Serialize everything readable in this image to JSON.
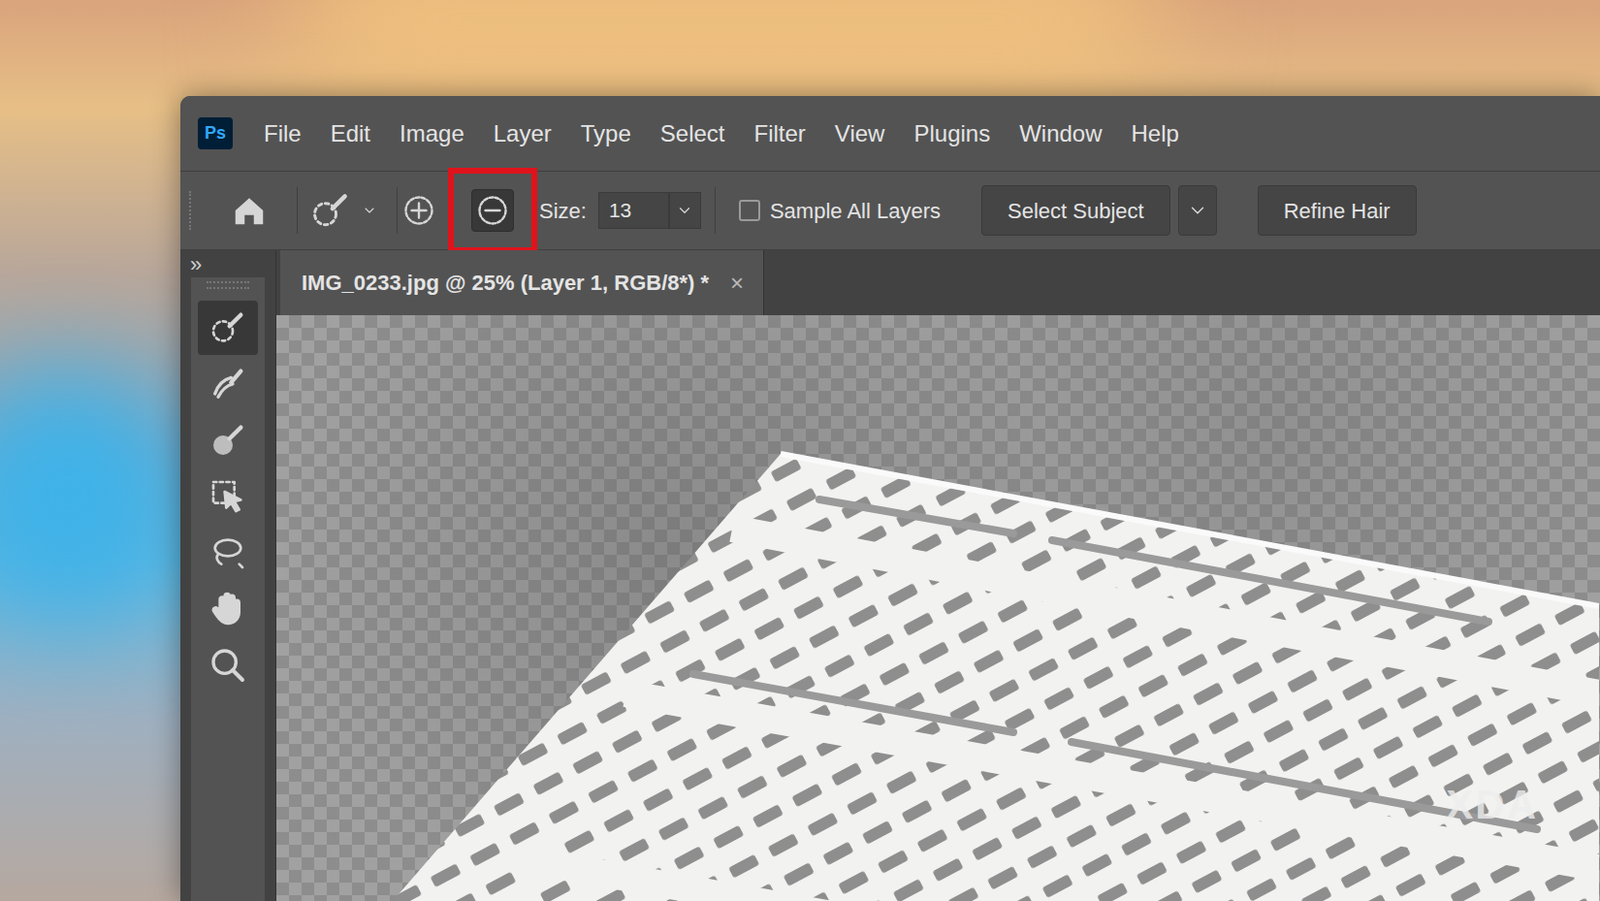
{
  "app": {
    "logo": "Ps"
  },
  "menu": [
    "File",
    "Edit",
    "Image",
    "Layer",
    "Type",
    "Select",
    "Filter",
    "View",
    "Plugins",
    "Window",
    "Help"
  ],
  "options": {
    "modes": [
      {
        "name": "add",
        "selected": false
      },
      {
        "name": "subtract",
        "selected": true
      }
    ],
    "size_label": "Size:",
    "size_value": "13",
    "sample_all_layers": {
      "label": "Sample All Layers",
      "checked": false
    },
    "buttons": [
      "Select Subject",
      "Refine Hair"
    ]
  },
  "panel_toggle": "»",
  "tools": [
    {
      "selected": true
    },
    {
      "selected": false
    },
    {
      "selected": false
    },
    {
      "selected": false
    },
    {
      "selected": false
    },
    {
      "selected": false
    },
    {
      "selected": false
    }
  ],
  "tabs": [
    {
      "label": "IMG_0233.jpg @ 25% (Layer 1, RGB/8*) *",
      "close": "×",
      "selected": true
    }
  ],
  "watermark": "XDA"
}
